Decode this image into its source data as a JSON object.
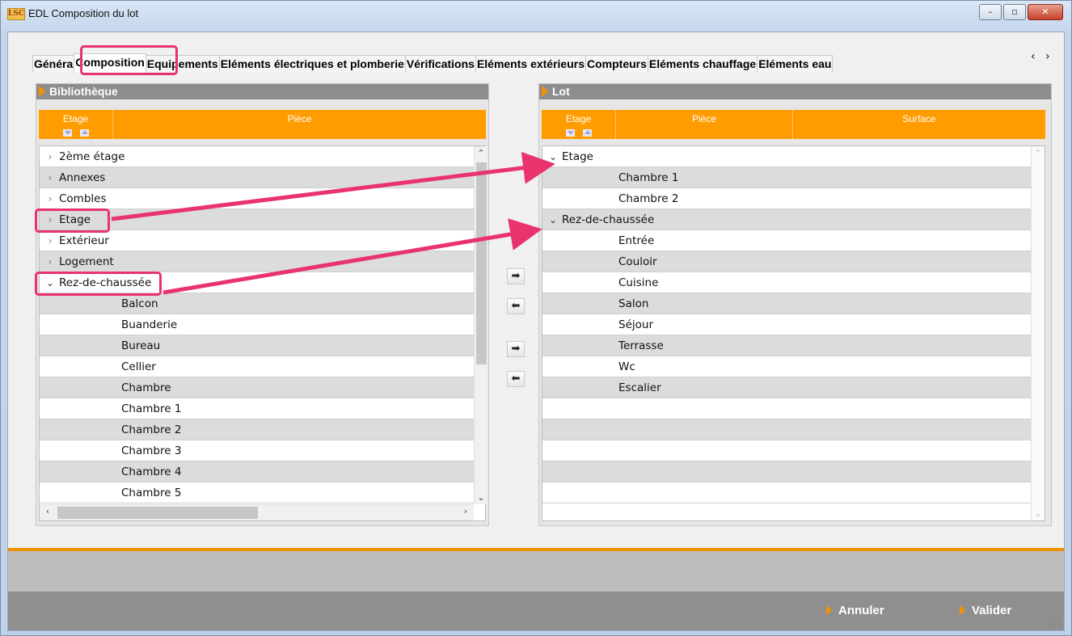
{
  "window": {
    "logo_text": "LSC",
    "title": "EDL Composition du lot",
    "minimize": "–",
    "maximize": "▫",
    "close": "✕"
  },
  "tabs": [
    {
      "label": "Généra",
      "active": false
    },
    {
      "label": "Composition",
      "active": true
    },
    {
      "label": "Equipements",
      "active": false
    },
    {
      "label": "Eléments électriques et plomberie",
      "active": false
    },
    {
      "label": "Vérifications",
      "active": false
    },
    {
      "label": "Eléments extérieurs",
      "active": false
    },
    {
      "label": "Compteurs",
      "active": false
    },
    {
      "label": "Eléments chauffage",
      "active": false
    },
    {
      "label": "Eléments eau",
      "active": false
    }
  ],
  "tab_scroll": "‹ ›",
  "library": {
    "title": "Bibliothèque",
    "col_floor": "Etage",
    "col_room": "Pièce",
    "rows": [
      {
        "label": "2ème étage",
        "level": 0,
        "expand": "closed"
      },
      {
        "label": "Annexes",
        "level": 0,
        "expand": "closed"
      },
      {
        "label": "Combles",
        "level": 0,
        "expand": "closed"
      },
      {
        "label": "Etage",
        "level": 0,
        "expand": "closed"
      },
      {
        "label": "Extérieur",
        "level": 0,
        "expand": "closed"
      },
      {
        "label": "Logement",
        "level": 0,
        "expand": "closed"
      },
      {
        "label": "Rez-de-chaussée",
        "level": 0,
        "expand": "open"
      },
      {
        "label": "Balcon",
        "level": 1
      },
      {
        "label": "Buanderie",
        "level": 1
      },
      {
        "label": "Bureau",
        "level": 1
      },
      {
        "label": "Cellier",
        "level": 1
      },
      {
        "label": "Chambre",
        "level": 1
      },
      {
        "label": "Chambre 1",
        "level": 1
      },
      {
        "label": "Chambre 2",
        "level": 1
      },
      {
        "label": "Chambre 3",
        "level": 1
      },
      {
        "label": "Chambre 4",
        "level": 1
      },
      {
        "label": "Chambre 5",
        "level": 1
      }
    ]
  },
  "lot": {
    "title": "Lot",
    "col_floor": "Etage",
    "col_room": "Pièce",
    "col_surface": "Surface",
    "rows": [
      {
        "label": "Etage",
        "level": 0,
        "expand": "open"
      },
      {
        "label": "Chambre 1",
        "level": 1
      },
      {
        "label": "Chambre 2",
        "level": 1
      },
      {
        "label": "Rez-de-chaussée",
        "level": 0,
        "expand": "open"
      },
      {
        "label": "Entrée",
        "level": 1
      },
      {
        "label": "Couloir",
        "level": 1
      },
      {
        "label": "Cuisine",
        "level": 1
      },
      {
        "label": "Salon",
        "level": 1
      },
      {
        "label": "Séjour",
        "level": 1
      },
      {
        "label": "Terrasse",
        "level": 1
      },
      {
        "label": "Wc",
        "level": 1
      },
      {
        "label": "Escalier",
        "level": 1
      },
      {
        "label": "",
        "level": 1
      },
      {
        "label": "",
        "level": 1
      },
      {
        "label": "",
        "level": 1
      },
      {
        "label": "",
        "level": 1
      },
      {
        "label": "",
        "level": 1
      }
    ]
  },
  "transfer_buttons": {
    "add": "➡",
    "remove": "⬅",
    "add_all": "➡",
    "remove_all": "⬅"
  },
  "actions": {
    "cancel": "Annuler",
    "validate": "Valider"
  },
  "colors": {
    "accent": "#ff9c00",
    "annotation": "#e8336d",
    "header_gray": "#8d8d8d"
  }
}
